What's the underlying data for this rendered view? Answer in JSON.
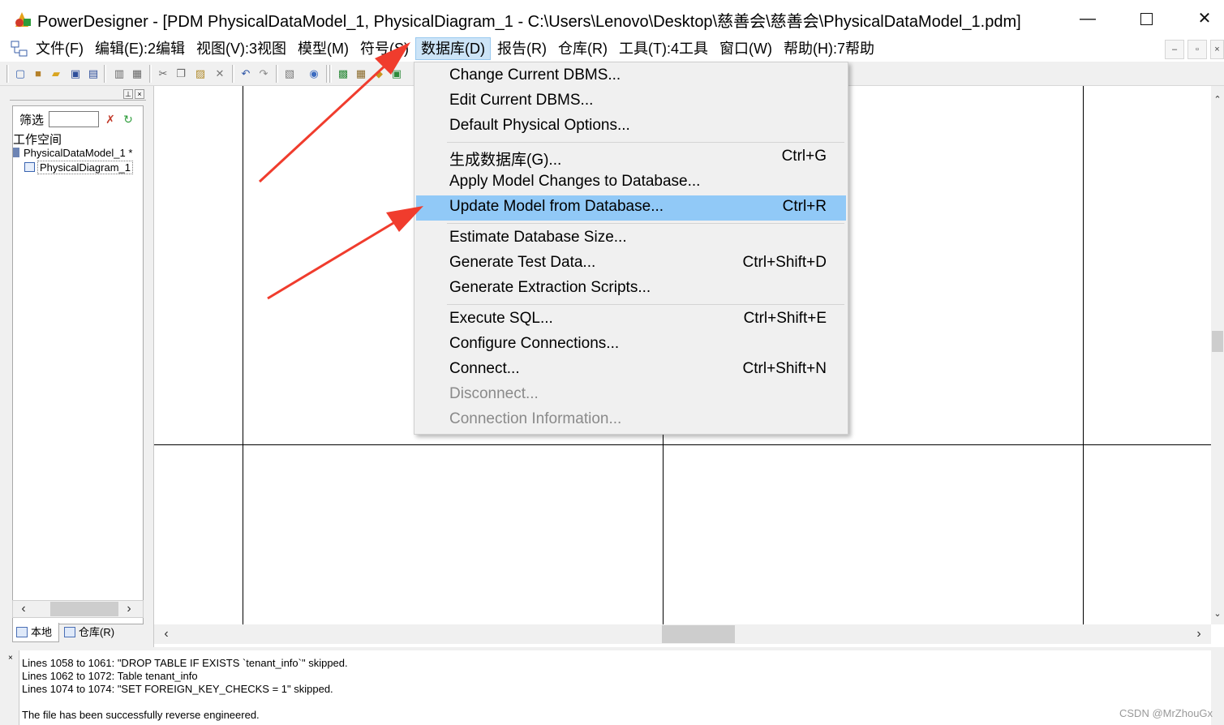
{
  "window": {
    "title": "PowerDesigner - [PDM PhysicalDataModel_1, PhysicalDiagram_1 - C:\\Users\\Lenovo\\Desktop\\慈善会\\慈善会\\PhysicalDataModel_1.pdm]",
    "minimize": "—",
    "close": "✕"
  },
  "menubar": {
    "items": [
      {
        "label": "文件(F)"
      },
      {
        "label": "编辑(E):2编辑"
      },
      {
        "label": "视图(V):3视图"
      },
      {
        "label": "模型(M)"
      },
      {
        "label": "符号(S)"
      },
      {
        "label": "数据库(D)"
      },
      {
        "label": "报告(R)"
      },
      {
        "label": "仓库(R)"
      },
      {
        "label": "工具(T):4工具"
      },
      {
        "label": "窗口(W)"
      },
      {
        "label": "帮助(H):7帮助"
      }
    ],
    "active_index": 5
  },
  "browser": {
    "filter_label": "筛选",
    "root": "工作空间",
    "model": "PhysicalDataModel_1 *",
    "diagram": "PhysicalDiagram_1",
    "tab_local": "本地",
    "tab_repo": "仓库(R)"
  },
  "database_menu": {
    "groups": [
      [
        {
          "label": "Change Current DBMS...",
          "shortcut": ""
        },
        {
          "label": "Edit Current DBMS...",
          "shortcut": ""
        },
        {
          "label": "Default Physical Options...",
          "shortcut": ""
        }
      ],
      [
        {
          "label": "生成数据库(G)...",
          "shortcut": "Ctrl+G"
        },
        {
          "label": "Apply Model Changes to Database...",
          "shortcut": ""
        },
        {
          "label": "Update Model from Database...",
          "shortcut": "Ctrl+R",
          "highlighted": true
        }
      ],
      [
        {
          "label": "Estimate Database Size...",
          "shortcut": ""
        },
        {
          "label": "Generate Test Data...",
          "shortcut": "Ctrl+Shift+D"
        },
        {
          "label": "Generate Extraction Scripts...",
          "shortcut": ""
        }
      ],
      [
        {
          "label": "Execute SQL...",
          "shortcut": "Ctrl+Shift+E"
        },
        {
          "label": "Configure Connections...",
          "shortcut": ""
        },
        {
          "label": "Connect...",
          "shortcut": "Ctrl+Shift+N"
        },
        {
          "label": "Disconnect...",
          "shortcut": "",
          "disabled": true
        },
        {
          "label": "Connection Information...",
          "shortcut": "",
          "disabled": true
        }
      ]
    ]
  },
  "output": {
    "lines": [
      "Lines 1058 to 1061:  \"DROP TABLE IF EXISTS `tenant_info`\" skipped.",
      "Lines 1062 to 1072:  Table tenant_info",
      "Lines 1074 to 1074:  \"SET FOREIGN_KEY_CHECKS = 1\" skipped.",
      "",
      "The file has been successfully reverse engineered."
    ]
  },
  "watermark": "CSDN @MrZhouGx",
  "colors": {
    "menu_highlight": "#91c9f7",
    "active_menu": "#cce4f7",
    "annotation_arrow": "#f03c2d"
  }
}
